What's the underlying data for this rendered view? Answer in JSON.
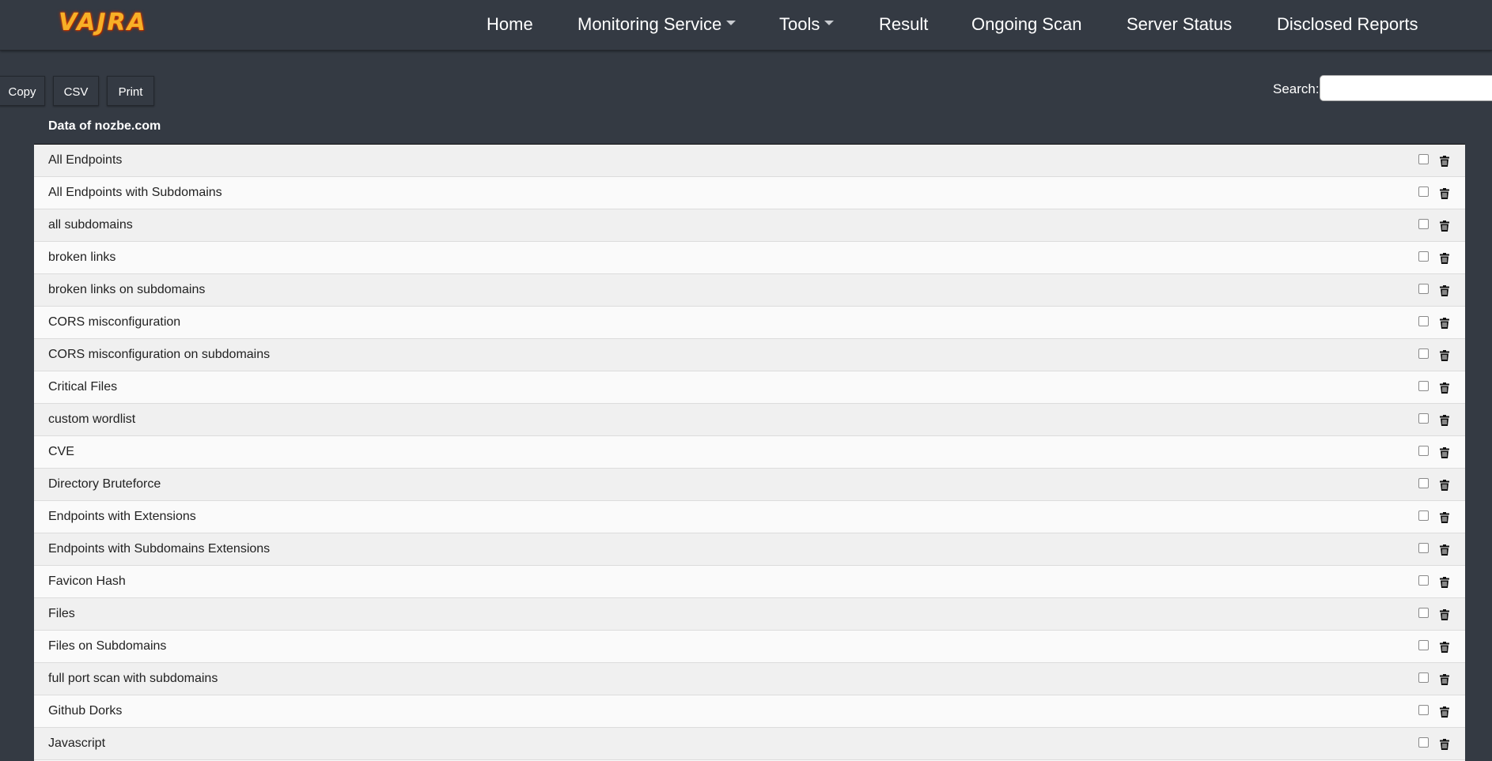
{
  "brand": {
    "logo_text": "VAJRA"
  },
  "nav": {
    "items": [
      {
        "label": "Home",
        "dropdown": false
      },
      {
        "label": "Monitoring Service",
        "dropdown": true
      },
      {
        "label": "Tools",
        "dropdown": true
      },
      {
        "label": "Result",
        "dropdown": false
      },
      {
        "label": "Ongoing Scan",
        "dropdown": false
      },
      {
        "label": "Server Status",
        "dropdown": false
      },
      {
        "label": "Disclosed Reports",
        "dropdown": false
      }
    ]
  },
  "toolbar": {
    "copy_label": "Copy",
    "csv_label": "CSV",
    "print_label": "Print"
  },
  "search": {
    "label": "Search:",
    "value": "",
    "placeholder": ""
  },
  "table": {
    "title": "Data of nozbe.com",
    "rows": [
      {
        "label": "All Endpoints",
        "checked": false
      },
      {
        "label": "All Endpoints with Subdomains",
        "checked": false
      },
      {
        "label": "all subdomains",
        "checked": false
      },
      {
        "label": "broken links",
        "checked": false
      },
      {
        "label": "broken links on subdomains",
        "checked": false
      },
      {
        "label": "CORS misconfiguration",
        "checked": false
      },
      {
        "label": "CORS misconfiguration on subdomains",
        "checked": false
      },
      {
        "label": "Critical Files",
        "checked": false
      },
      {
        "label": "custom wordlist",
        "checked": false
      },
      {
        "label": "CVE",
        "checked": false
      },
      {
        "label": "Directory Bruteforce",
        "checked": false
      },
      {
        "label": "Endpoints with Extensions",
        "checked": false
      },
      {
        "label": "Endpoints with Subdomains Extensions",
        "checked": false
      },
      {
        "label": "Favicon Hash",
        "checked": false
      },
      {
        "label": "Files",
        "checked": false
      },
      {
        "label": "Files on Subdomains",
        "checked": false
      },
      {
        "label": "full port scan with subdomains",
        "checked": false
      },
      {
        "label": "Github Dorks",
        "checked": false
      },
      {
        "label": "Javascript",
        "checked": false
      }
    ]
  },
  "icons": {
    "row_action": "trash-icon",
    "dropdown": "caret-down-icon"
  },
  "colors": {
    "background": "#343a43",
    "row_odd": "#f0f0f0",
    "row_even": "#fafafa",
    "logo": "#f7b027"
  }
}
